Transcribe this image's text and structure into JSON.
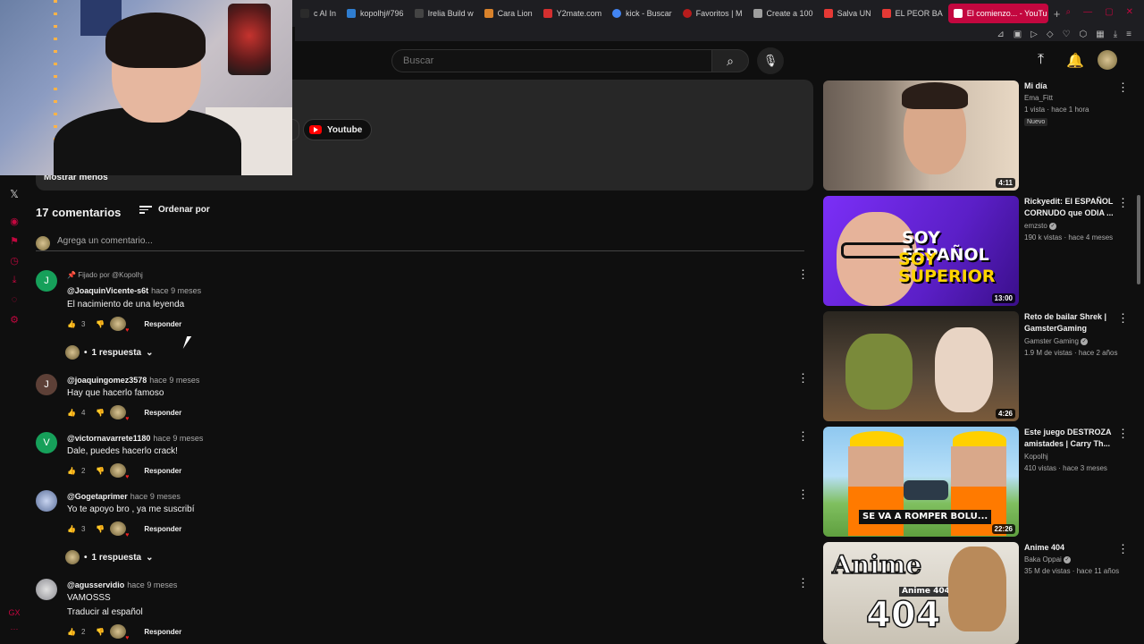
{
  "browser": {
    "tabs": [
      {
        "label": "c AI In",
        "color": "#2b2b2b"
      },
      {
        "label": "kopolhj#796",
        "color": "#2f7dd0"
      },
      {
        "label": "Irelia Build w",
        "color": "#444"
      },
      {
        "label": "Cara Lion",
        "color": "#d9822b"
      },
      {
        "label": "Y2mate.com",
        "color": "#d32f2f"
      },
      {
        "label": "kick - Buscar",
        "color": "#4285f4"
      },
      {
        "label": "Favoritos | M",
        "color": "#b71c1c"
      },
      {
        "label": "Create a 100",
        "color": "#9e9e9e"
      },
      {
        "label": "Salva UN",
        "color": "#e53935"
      },
      {
        "label": "EL PEOR BA",
        "color": "#e53935"
      }
    ],
    "active_tab": "El comienzo... - YouTu",
    "new_tab": "+"
  },
  "header": {
    "search_placeholder": "Buscar"
  },
  "description": {
    "chip_label": "Youtube",
    "show_less": "Mostrar menos"
  },
  "comments_section": {
    "count": "17 comentarios",
    "sort_label": "Ordenar por",
    "add_placeholder": "Agrega un comentario...",
    "reply_label": "Responder",
    "pinned_label": "Fijado por @Kopolhj",
    "comments": [
      {
        "initial": "J",
        "avatar_color": "#16a05a",
        "author": "@JoaquinVicente-s6t",
        "time": "hace 9 meses",
        "text": "El nacimiento de una leyenda",
        "likes": "3",
        "replies": "1 respuesta"
      },
      {
        "initial": "J",
        "avatar_color": "#5d4037",
        "author": "@joaquingomez3578",
        "time": "hace 9 meses",
        "text": "Hay que hacerlo famoso",
        "likes": "4"
      },
      {
        "initial": "V",
        "avatar_color": "#16a05a",
        "author": "@victornavarrete1180",
        "time": "hace 9 meses",
        "text": "Dale, puedes hacerlo crack!",
        "likes": "2"
      },
      {
        "initial": "",
        "avatar_color": "#6a7fa5",
        "author": "@Gogetaprimer",
        "time": "hace 9 meses",
        "text": "Yo te apoyo bro , ya me suscribí",
        "likes": "3",
        "replies": "1 respuesta"
      },
      {
        "initial": "",
        "avatar_color": "#9a9aa0",
        "author": "@agusservidio",
        "time": "hace 9 meses",
        "text": "VAMOSSS",
        "translate": "Traducir al español",
        "likes": "2"
      }
    ]
  },
  "recommendations": [
    {
      "title": "Mi día",
      "channel": "Ema_Fitt",
      "meta": "1 vista · hace 1 hora",
      "badge": "Nuevo",
      "duration": "4:11",
      "verified": false
    },
    {
      "title": "Rickyedit: El ESPAÑOL CORNUDO que ODIA ...",
      "channel": "emzsto",
      "meta": "190 k vistas · hace 4 meses",
      "duration": "13:00",
      "verified": true,
      "thumb_text": [
        "SOY ESPAÑOL",
        "SOY SUPERIOR"
      ]
    },
    {
      "title": "Reto de bailar Shrek | GamsterGaming",
      "channel": "Gamster Gaming",
      "meta": "1.9 M de vistas · hace 2 años",
      "duration": "4:26",
      "verified": true
    },
    {
      "title": "Este juego DESTROZA amistades | Carry Th...",
      "channel": "Kopolhj",
      "meta": "410 vistas · hace 3 meses",
      "duration": "22:26",
      "verified": false,
      "thumb_text": [
        "SE VA A ROMPER BOLU..."
      ]
    },
    {
      "title": "Anime 404",
      "channel": "Baka Oppai",
      "meta": "35 M de vistas · hace 11 años",
      "verified": true,
      "thumb_text": [
        "Anime",
        "404",
        "Anime 404"
      ]
    }
  ]
}
